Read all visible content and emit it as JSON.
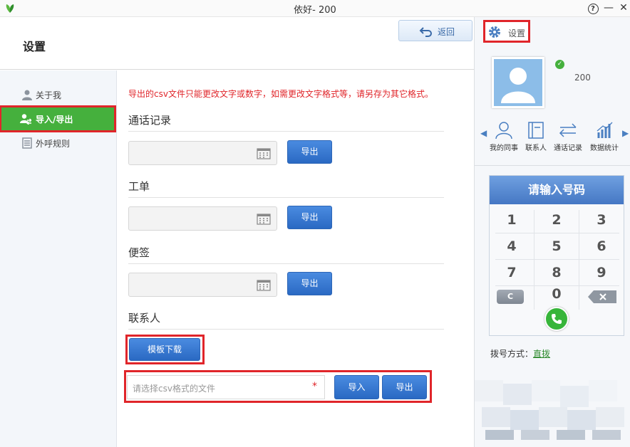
{
  "window": {
    "title": "依好- 200",
    "help_glyph": "?",
    "minimize_glyph": "—",
    "close_glyph": "✕"
  },
  "header": {
    "page_title": "设置",
    "back_label": "返回"
  },
  "sidebar": {
    "items": [
      {
        "label": "关于我",
        "icon": "person-icon",
        "active": false
      },
      {
        "label": "导入/导出",
        "icon": "import-export-icon",
        "active": true
      },
      {
        "label": "外呼规则",
        "icon": "rules-icon",
        "active": false
      }
    ]
  },
  "main": {
    "warning": "导出的csv文件只能更改文字或数字，如需更改文字格式等，请另存为其它格式。",
    "sections": [
      {
        "title": "通话记录",
        "export_label": "导出"
      },
      {
        "title": "工单",
        "export_label": "导出"
      },
      {
        "title": "便签",
        "export_label": "导出"
      }
    ],
    "contacts": {
      "title": "联系人",
      "template_label": "模板下载",
      "file_placeholder": "请选择csv格式的文件",
      "required_mark": "*",
      "import_label": "导入",
      "export_label": "导出"
    }
  },
  "right_panel": {
    "settings_label": "设置",
    "user_number": "200",
    "online_check": "✓",
    "nav": [
      {
        "label": "我的同事",
        "icon": "colleague-icon"
      },
      {
        "label": "联系人",
        "icon": "contacts-book-icon"
      },
      {
        "label": "通话记录",
        "icon": "call-log-icon"
      },
      {
        "label": "数据统计",
        "icon": "stats-icon"
      }
    ],
    "nav_prev": "◀",
    "nav_next": "▶",
    "dialpad": {
      "header": "请输入号码",
      "keys": [
        "1",
        "2",
        "3",
        "4",
        "5",
        "6",
        "7",
        "8",
        "9"
      ],
      "zero": "0",
      "clear": "C"
    },
    "dial_mode_label": "拨号方式：",
    "dial_mode_value": "直拨"
  },
  "colors": {
    "accent_green": "#45b03d",
    "highlight_red": "#e0252a",
    "button_blue": "#2a69c3"
  }
}
